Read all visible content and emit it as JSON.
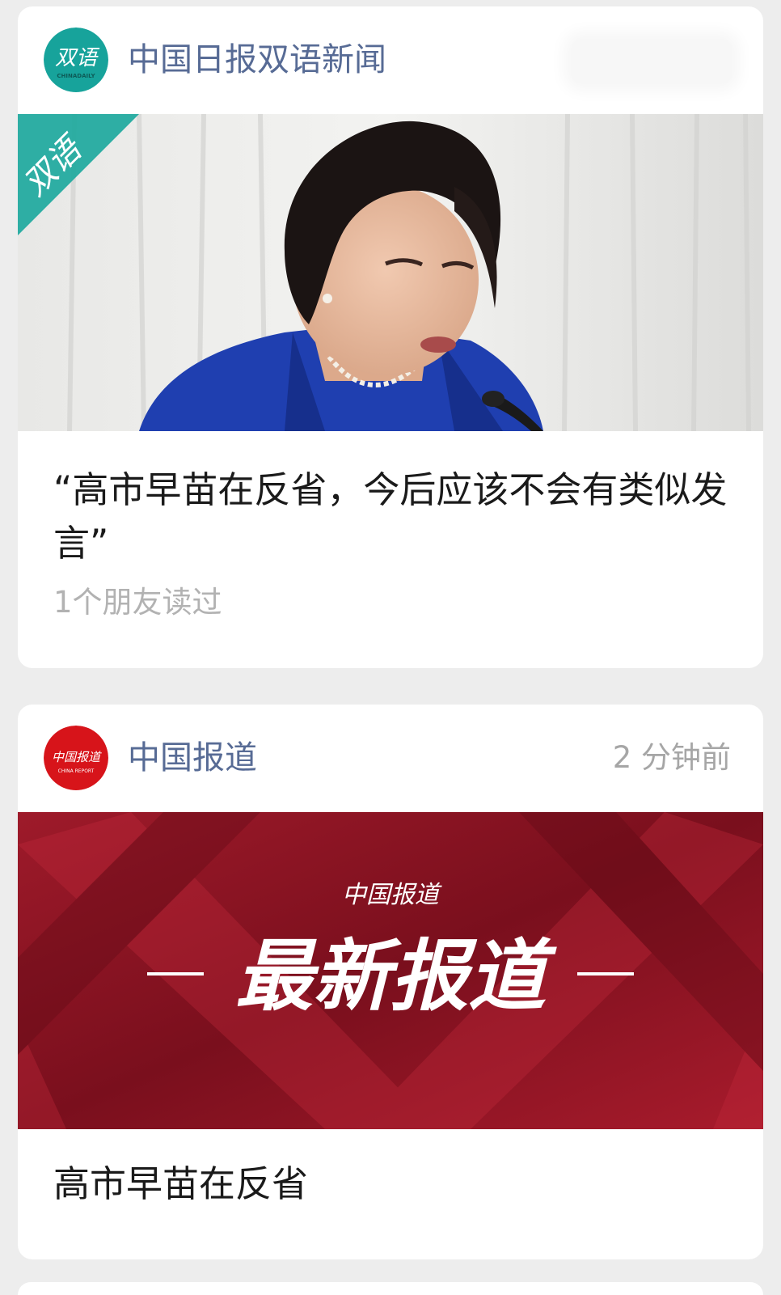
{
  "feed": {
    "articles": [
      {
        "account_name": "中国日报双语新闻",
        "avatar_text": "双语",
        "avatar_subtext": "CHINADAILY",
        "cover_badge": "双语",
        "title": "“高市早苗在反省，今后应该不会有类似发言”",
        "read_count": "1个朋友读过",
        "accent_color": "#1aa39a"
      },
      {
        "account_name": "中国报道",
        "time": "2 分钟前",
        "avatar_text": "中国报道",
        "avatar_subtext": "CHINA REPORT",
        "cover_brand": "中国报道",
        "cover_headline": "最新报道",
        "title": "高市早苗在反省",
        "accent_color": "#c8102e"
      }
    ]
  }
}
